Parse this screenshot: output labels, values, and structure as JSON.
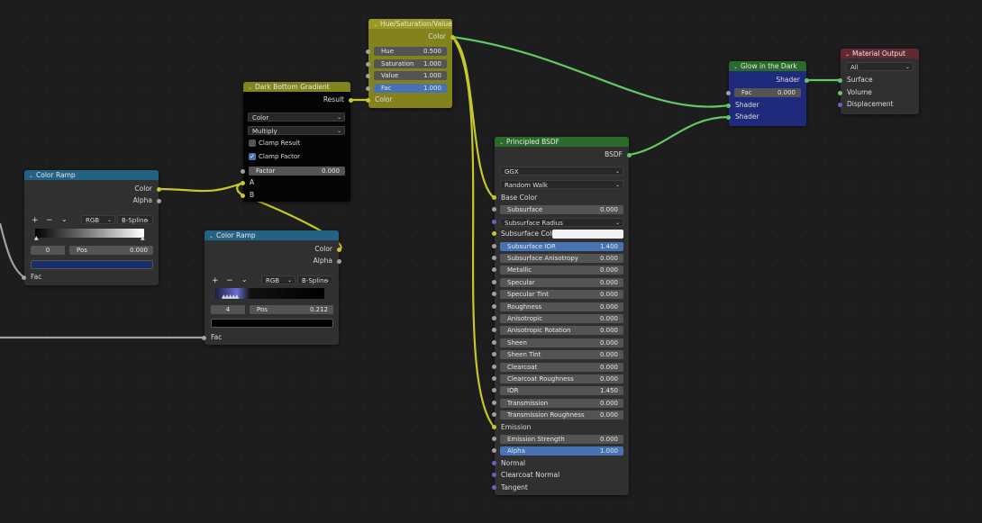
{
  "colors": {
    "bg": "#1d1d1d",
    "socket_color": "#c7c729",
    "socket_shader": "#63c763",
    "socket_float": "#a1a1a1",
    "socket_vector": "#6363c7",
    "header_color": "#83831e",
    "header_shader": "#2a6b2a",
    "header_converter": "#246283",
    "header_output": "#632830",
    "field_active": "#4772b3"
  },
  "nodes": {
    "colorramp1": {
      "title": "Color Ramp",
      "out_color": "Color",
      "out_alpha": "Alpha",
      "add": "+",
      "remove": "−",
      "menu": "⌄",
      "mode": "RGB",
      "interp": "B-Spline",
      "index": "0",
      "pos_label": "Pos",
      "pos_value": "0.000",
      "in_fac": "Fac"
    },
    "dark_gradient": {
      "title": "Dark Bottom Gradient",
      "out_result": "Result",
      "type": "Color",
      "blend": "Multiply",
      "clamp_result": "Clamp Result",
      "clamp_factor": "Clamp Factor",
      "factor_label": "Factor",
      "factor_value": "0.000",
      "in_a": "A",
      "in_b": "B"
    },
    "colorramp2": {
      "title": "Color Ramp",
      "out_color": "Color",
      "out_alpha": "Alpha",
      "add": "+",
      "remove": "−",
      "menu": "⌄",
      "mode": "RGB",
      "interp": "B-Spline",
      "index": "4",
      "pos_label": "Pos",
      "pos_value": "0.212",
      "in_fac": "Fac"
    },
    "hsv": {
      "title": "Hue/Saturation/Value",
      "out_color": "Color",
      "hue_label": "Hue",
      "hue_value": "0.500",
      "sat_label": "Saturation",
      "sat_value": "1.000",
      "val_label": "Value",
      "val_value": "1.000",
      "fac_label": "Fac",
      "fac_value": "1.000",
      "in_color": "Color"
    },
    "bsdf": {
      "title": "Principled BSDF",
      "out_bsdf": "BSDF",
      "distribution": "GGX",
      "subsurface_method": "Random Walk",
      "inputs": [
        {
          "kind": "socket",
          "label": "Base Color",
          "sock": "y"
        },
        {
          "kind": "field",
          "label": "Subsurface",
          "value": "0.000",
          "sock": "gr"
        },
        {
          "kind": "dropdown",
          "label": "Subsurface Radius",
          "sock": "p"
        },
        {
          "kind": "color",
          "label": "Subsurface Color",
          "sock": "y"
        },
        {
          "kind": "field",
          "label": "Subsurface IOR",
          "value": "1.400",
          "sock": "gr",
          "active": true
        },
        {
          "kind": "field",
          "label": "Subsurface Anisotropy",
          "value": "0.000",
          "sock": "gr"
        },
        {
          "kind": "field",
          "label": "Metallic",
          "value": "0.000",
          "sock": "gr"
        },
        {
          "kind": "field",
          "label": "Specular",
          "value": "0.000",
          "sock": "gr"
        },
        {
          "kind": "field",
          "label": "Specular Tint",
          "value": "0.000",
          "sock": "gr"
        },
        {
          "kind": "field",
          "label": "Roughness",
          "value": "0.000",
          "sock": "gr"
        },
        {
          "kind": "field",
          "label": "Anisotropic",
          "value": "0.000",
          "sock": "gr"
        },
        {
          "kind": "field",
          "label": "Anisotropic Rotation",
          "value": "0.000",
          "sock": "gr"
        },
        {
          "kind": "field",
          "label": "Sheen",
          "value": "0.000",
          "sock": "gr"
        },
        {
          "kind": "field",
          "label": "Sheen Tint",
          "value": "0.000",
          "sock": "gr"
        },
        {
          "kind": "field",
          "label": "Clearcoat",
          "value": "0.000",
          "sock": "gr"
        },
        {
          "kind": "field",
          "label": "Clearcoat Roughness",
          "value": "0.000",
          "sock": "gr"
        },
        {
          "kind": "field",
          "label": "IOR",
          "value": "1.450",
          "sock": "gr"
        },
        {
          "kind": "field",
          "label": "Transmission",
          "value": "0.000",
          "sock": "gr"
        },
        {
          "kind": "field",
          "label": "Transmission Roughness",
          "value": "0.000",
          "sock": "gr"
        },
        {
          "kind": "socket",
          "label": "Emission",
          "sock": "y"
        },
        {
          "kind": "field",
          "label": "Emission Strength",
          "value": "0.000",
          "sock": "gr"
        },
        {
          "kind": "field",
          "label": "Alpha",
          "value": "1.000",
          "sock": "gr",
          "active": true
        },
        {
          "kind": "socket",
          "label": "Normal",
          "sock": "p"
        },
        {
          "kind": "socket",
          "label": "Clearcoat Normal",
          "sock": "p"
        },
        {
          "kind": "socket",
          "label": "Tangent",
          "sock": "p"
        }
      ]
    },
    "glow": {
      "title": "Glow in the Dark",
      "out_shader": "Shader",
      "fac_label": "Fac",
      "fac_value": "0.000",
      "in_shader1": "Shader",
      "in_shader2": "Shader"
    },
    "output": {
      "title": "Material Output",
      "target": "All",
      "in_surface": "Surface",
      "in_volume": "Volume",
      "in_displacement": "Displacement"
    }
  }
}
